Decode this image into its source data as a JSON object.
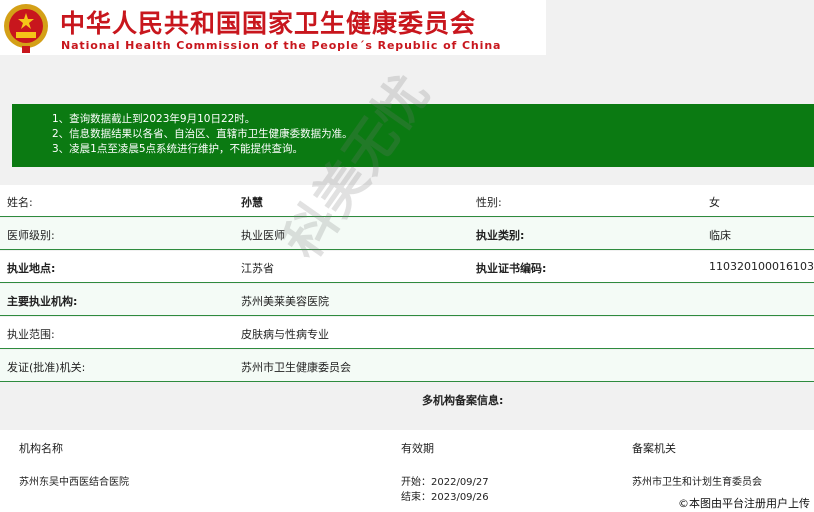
{
  "header": {
    "title_cn": "中华人民共和国国家卫生健康委员会",
    "title_en": "National Health Commission of the People´s Republic of China"
  },
  "notice": {
    "lines": [
      "1、查询数据截止到2023年9月10日22时。",
      "2、信息数据结果以各省、自治区、直辖市卫生健康委数据为准。",
      "3、凌晨1点至凌晨5点系统进行维护，不能提供查询。"
    ]
  },
  "record": {
    "name_label": "姓名:",
    "name_value": "孙慧",
    "gender_label": "性别:",
    "gender_value": "女",
    "level_label": "医师级别:",
    "level_value": "执业医师",
    "category_label": "执业类别:",
    "category_value": "临床",
    "location_label": "执业地点:",
    "location_value": "江苏省",
    "cert_label": "执业证书编码:",
    "cert_value": "110320100016103",
    "institution_label": "主要执业机构:",
    "institution_value": "苏州美莱美容医院",
    "scope_label": "执业范围:",
    "scope_value": "皮肤病与性病专业",
    "issuer_label": "发证(批准)机关:",
    "issuer_value": "苏州市卫生健康委员会"
  },
  "multi": {
    "title": "多机构备案信息:",
    "columns": [
      "机构名称",
      "有效期",
      "备案机关"
    ],
    "rows": [
      {
        "name": "苏州东吴中西医结合医院",
        "start": "开始：2022/09/27",
        "end": "结束：2023/09/26",
        "authority": "苏州市卫生和计划生育委员会"
      }
    ]
  },
  "watermark": "科美无忧",
  "credit": "©本图由平台注册用户上传",
  "colors": {
    "brand_red": "#c8161d",
    "notice_green": "#0b7a12",
    "row_border": "#2e8b3e"
  }
}
